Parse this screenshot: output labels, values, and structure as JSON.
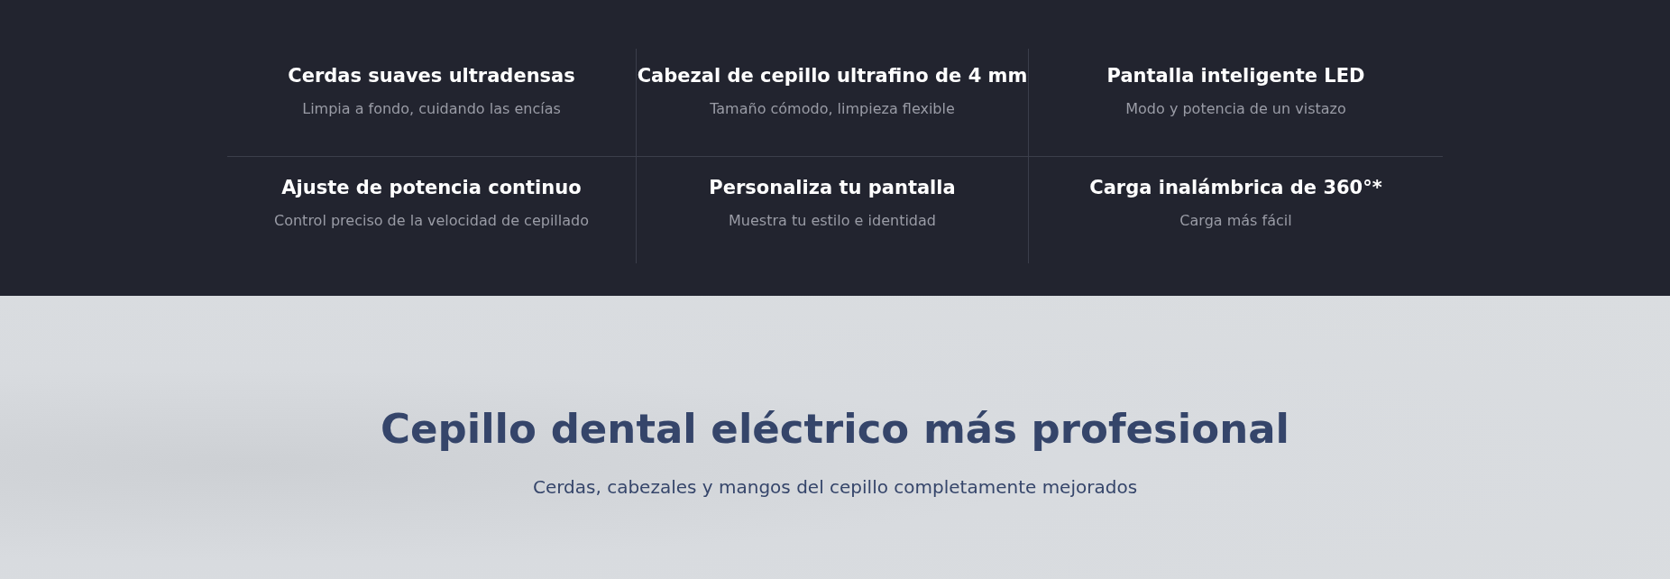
{
  "features": [
    {
      "title": "Cerdas suaves ultradensas",
      "subtitle": "Limpia a fondo, cuidando las encías"
    },
    {
      "title": "Cabezal de cepillo ultrafino de 4 mm",
      "subtitle": "Tamaño cómodo, limpieza flexible"
    },
    {
      "title": "Pantalla inteligente LED",
      "subtitle": "Modo y potencia de un vistazo"
    },
    {
      "title": "Ajuste de potencia continuo",
      "subtitle": "Control preciso de la velocidad de cepillado"
    },
    {
      "title": "Personaliza tu pantalla",
      "subtitle": "Muestra tu estilo e identidad"
    },
    {
      "title": "Carga inalámbrica de 360°*",
      "subtitle": "Carga más fácil"
    }
  ],
  "hero": {
    "heading": "Cepillo dental eléctrico más profesional",
    "subheading": "Cerdas, cabezales y mangos del cepillo completamente mejorados"
  }
}
